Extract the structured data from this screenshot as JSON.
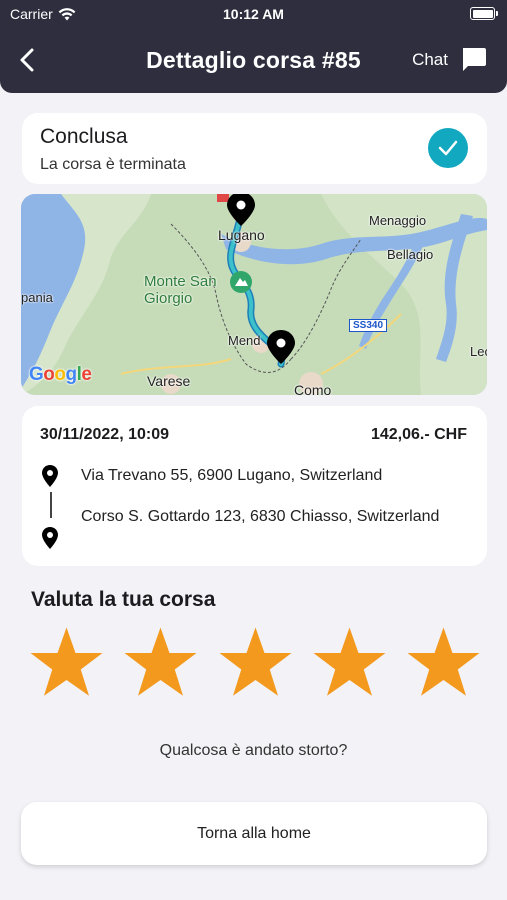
{
  "status_bar": {
    "carrier": "Carrier",
    "time": "10:12 AM"
  },
  "nav": {
    "title": "Dettaglio corsa #85",
    "chat_label": "Chat"
  },
  "ride_status": {
    "title": "Conclusa",
    "subtitle": "La corsa è terminata"
  },
  "map": {
    "labels": {
      "lugano": "Lugano",
      "menaggio": "Menaggio",
      "bellagio": "Bellagio",
      "monte_san_giorgio": "Monte San\nGiorgio",
      "mendrisio": "Mend",
      "varese": "Varese",
      "como": "Como",
      "road": "SS340",
      "paia": "pania",
      "lec": "Lec"
    },
    "attribution": "Google"
  },
  "trip": {
    "date": "30/11/2022, 10:09",
    "price": "142,06.- CHF",
    "pickup": "Via Trevano 55, 6900 Lugano, Switzerland",
    "dropoff": "Corso S. Gottardo 123, 6830 Chiasso, Switzerland"
  },
  "rating": {
    "title": "Valuta la tua corsa",
    "stars_total": 5,
    "stars_selected": 5
  },
  "problem_link": "Qualcosa è andato storto?",
  "home_button": "Torna alla home",
  "colors": {
    "header": "#2e2e3e",
    "accent": "#12a8bf",
    "star": "#f39a1e",
    "background": "#f2f2f7"
  }
}
